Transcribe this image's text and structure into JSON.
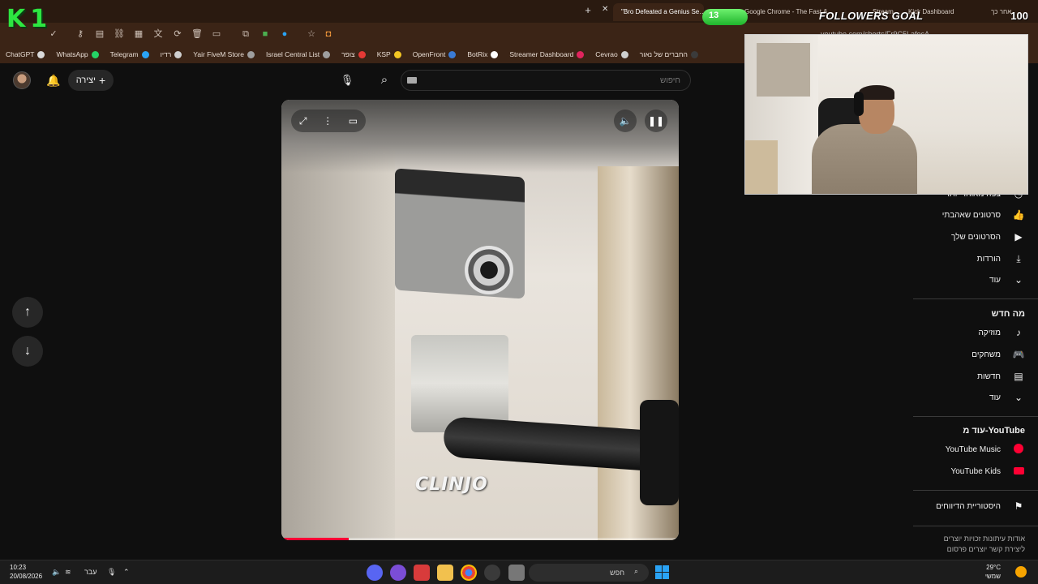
{
  "browser": {
    "tabs": [
      {
        "label": "\"Bro Defeated a Genius Se…",
        "active": true
      },
      {
        "label": "Google Chrome - The Fast & …",
        "active": false
      },
      {
        "label": "Stream",
        "active": false
      },
      {
        "label": "Kick Dashboard",
        "active": false
      },
      {
        "label": "אחר כך",
        "active": false
      }
    ],
    "url": "youtube.com/shorts/Fr9C5LafocA",
    "bookmarks": [
      {
        "label": "החברים של נאור",
        "color": "#3b3b3b"
      },
      {
        "label": "Cevrao",
        "color": "#cfcfcf"
      },
      {
        "label": "Streamer Dashboard",
        "color": "#e0245e"
      },
      {
        "label": "BotRix",
        "color": "#ffffff"
      },
      {
        "label": "OpenFront",
        "color": "#3a7bd5"
      },
      {
        "label": "KSP",
        "color": "#f3c623"
      },
      {
        "label": "צופר",
        "color": "#e53935"
      },
      {
        "label": "Israel Central List",
        "color": "#9e9e9e"
      },
      {
        "label": "Yair FiveM Store",
        "color": "#9e9e9e"
      },
      {
        "label": "רדיו",
        "color": "#cfcfcf"
      },
      {
        "label": "Telegram",
        "color": "#2aa3f5"
      },
      {
        "label": "WhatsApp",
        "color": "#25d366"
      },
      {
        "label": "ChatGPT",
        "color": "#d9d9d9"
      }
    ]
  },
  "youtube": {
    "create_label": "יצירה",
    "search_placeholder": "חיפוש",
    "sidebar": {
      "partial_item": "צפה מאוחר יותר",
      "you_items": [
        {
          "label": "סרטונים שאהבתי",
          "icon": "thumbs-up-icon"
        },
        {
          "label": "הסרטונים שלך",
          "icon": "my-videos-icon"
        },
        {
          "label": "הורדות",
          "icon": "download-icon"
        },
        {
          "label": "עוד",
          "icon": "chevron-down-icon"
        }
      ],
      "explore_title": "מה חדש",
      "explore_items": [
        {
          "label": "מוזיקה",
          "icon": "music-icon"
        },
        {
          "label": "משחקים",
          "icon": "gaming-icon"
        },
        {
          "label": "חדשות",
          "icon": "news-icon"
        },
        {
          "label": "עוד",
          "icon": "chevron-down-icon"
        }
      ],
      "more_title": "עוד מ-YouTube",
      "more_items": [
        {
          "label": "YouTube Music",
          "icon": "youtube-music-icon"
        },
        {
          "label": "YouTube Kids",
          "icon": "youtube-kids-icon"
        }
      ],
      "report_history": "היסטוריית הדיווחים",
      "footer_line1": "אודות  עיתונות  זכויות יוצרים",
      "footer_line2": "ליצירת קשר  יוצרים  פרסום"
    },
    "video": {
      "watermark": "CLINJO",
      "progress": 0.17
    }
  },
  "overlay": {
    "logo_text": "K1",
    "followers_count": "13",
    "followers_title": "FOLLOWERS GOAL",
    "followers_goal": "100",
    "followers_progress": 0.13
  },
  "taskbar": {
    "time": "10:23",
    "date": "20/08/2026",
    "language": "עבר",
    "search_placeholder": "חפש",
    "temperature": "29°C",
    "weather": "שמשי"
  }
}
